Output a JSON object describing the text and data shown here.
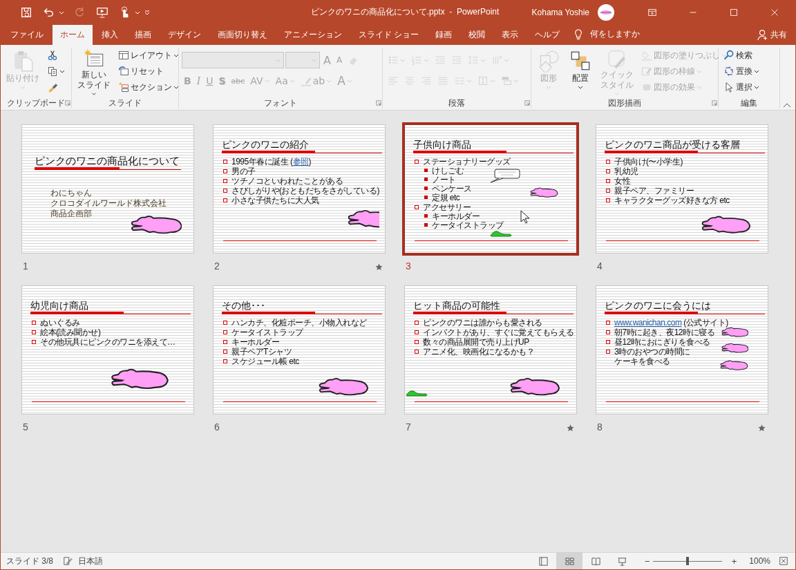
{
  "window": {
    "title": "ピンクのワニの商品化について.pptx  -  PowerPoint",
    "user": "Kohama Yoshie"
  },
  "tabs": [
    {
      "label": "ファイル",
      "selected": false
    },
    {
      "label": "ホーム",
      "selected": true
    },
    {
      "label": "挿入",
      "selected": false
    },
    {
      "label": "描画",
      "selected": false
    },
    {
      "label": "デザイン",
      "selected": false
    },
    {
      "label": "画面切り替え",
      "selected": false
    },
    {
      "label": "アニメーション",
      "selected": false
    },
    {
      "label": "スライド ショー",
      "selected": false
    },
    {
      "label": "録画",
      "selected": false
    },
    {
      "label": "校閲",
      "selected": false
    },
    {
      "label": "表示",
      "selected": false
    },
    {
      "label": "ヘルプ",
      "selected": false
    }
  ],
  "tell_me": "何をしますか",
  "share": "共有",
  "ribbon": {
    "groups": [
      {
        "kind": "stack",
        "label": "クリップボード",
        "launcher": true,
        "columns": [
          {
            "items": [
              {
                "kind": "paste",
                "label": "貼り付け",
                "caret": true,
                "disabled": true
              }
            ]
          },
          {
            "items": [
              {
                "kind": "cut",
                "caret": false,
                "disabled": false
              },
              {
                "kind": "copy",
                "caret": true,
                "disabled": false
              },
              {
                "kind": "painter",
                "caret": false,
                "disabled": false
              }
            ]
          }
        ]
      },
      {
        "kind": "stack",
        "label": "スライド",
        "launcher": false,
        "columns": [
          {
            "items": [
              {
                "kind": "new_slide",
                "lines": [
                  "新しい",
                  "スライド"
                ],
                "caret": true,
                "disabled": false
              }
            ]
          },
          {
            "items": [
              {
                "kind": "layout",
                "label": "レイアウト",
                "caret": true,
                "disabled": false
              },
              {
                "kind": "reset",
                "label": "リセット",
                "caret": false,
                "disabled": false
              },
              {
                "kind": "section",
                "label": "セクション",
                "caret": true,
                "disabled": false
              }
            ]
          }
        ]
      },
      {
        "kind": "rows",
        "label": "フォント",
        "launcher": true,
        "rows": [
          {
            "items": [
              {
                "kind": "font_name",
                "caret": true,
                "disabled": true
              },
              {
                "kind": "font_size",
                "caret": true,
                "disabled": true
              },
              {
                "kind": "grow",
                "label": "A",
                "caret": false,
                "disabled": true
              },
              {
                "kind": "shrink",
                "label": "A",
                "caret": false,
                "disabled": true
              },
              {
                "kind": "clear",
                "caret": false,
                "disabled": true
              }
            ]
          },
          {
            "items": [
              {
                "kind": "bold",
                "label": "B",
                "caret": false,
                "disabled": true
              },
              {
                "kind": "italic",
                "label": "I",
                "caret": false,
                "disabled": true
              },
              {
                "kind": "underline",
                "label": "U",
                "caret": false,
                "disabled": true
              },
              {
                "kind": "shadow",
                "label": "S",
                "caret": false,
                "disabled": true
              },
              {
                "kind": "strike",
                "label": "abc",
                "caret": false,
                "disabled": true
              },
              {
                "kind": "spacing",
                "label": "AV",
                "caret": true,
                "disabled": true
              },
              {
                "kind": "case",
                "label": "Aa",
                "caret": true,
                "disabled": true
              },
              {
                "kind": "highlight",
                "label": "ab",
                "caret": true,
                "disabled": true
              },
              {
                "kind": "color",
                "label": "A",
                "caret": true,
                "disabled": true
              }
            ]
          }
        ]
      },
      {
        "kind": "rows",
        "label": "段落",
        "launcher": true,
        "rows": [
          {
            "items": [
              {
                "kind": "bullets",
                "caret": true,
                "disabled": true
              },
              {
                "kind": "numbering",
                "caret": true,
                "disabled": true
              },
              {
                "kind": "outdent",
                "caret": false,
                "disabled": true
              },
              {
                "kind": "indent",
                "caret": false,
                "disabled": true
              },
              {
                "kind": "line_spacing",
                "caret": true,
                "disabled": true
              },
              {
                "kind": "text_direction",
                "caret": true,
                "disabled": true
              }
            ]
          },
          {
            "items": [
              {
                "kind": "left",
                "caret": false,
                "disabled": true
              },
              {
                "kind": "center",
                "caret": false,
                "disabled": true
              },
              {
                "kind": "right",
                "caret": false,
                "disabled": true
              },
              {
                "kind": "justify",
                "caret": false,
                "disabled": true
              },
              {
                "kind": "columns",
                "caret": true,
                "disabled": true
              },
              {
                "kind": "align_text",
                "caret": true,
                "disabled": true
              },
              {
                "kind": "smartart",
                "caret": true,
                "disabled": true
              }
            ]
          }
        ]
      },
      {
        "kind": "stack",
        "label": "図形描画",
        "launcher": true,
        "columns": [
          {
            "items": [
              {
                "kind": "shapes",
                "label": "図形",
                "caret": true,
                "disabled": true
              }
            ]
          },
          {
            "items": [
              {
                "kind": "arrange",
                "label": "配置",
                "caret": true,
                "disabled": false
              }
            ]
          },
          {
            "items": [
              {
                "kind": "quick_styles",
                "lines": [
                  "クイック",
                  "スタイル"
                ],
                "caret": true,
                "disabled": true
              }
            ]
          },
          {
            "items": [
              {
                "kind": "fill",
                "label": "図形の塗りつぶし",
                "caret": true,
                "disabled": true
              },
              {
                "kind": "outline",
                "label": "図形の枠線",
                "caret": true,
                "disabled": true
              },
              {
                "kind": "effects",
                "label": "図形の効果",
                "caret": true,
                "disabled": true
              }
            ]
          }
        ]
      },
      {
        "kind": "stack",
        "label": "編集",
        "launcher": false,
        "columns": [
          {
            "items": [
              {
                "kind": "find",
                "label": "検索",
                "caret": false,
                "disabled": false
              },
              {
                "kind": "replace",
                "label": "置換",
                "caret": true,
                "disabled": false
              },
              {
                "kind": "select",
                "label": "選択",
                "caret": true,
                "disabled": false
              }
            ]
          }
        ]
      }
    ]
  },
  "slides": [
    {
      "number": "1",
      "kind": "title",
      "title": "ピンクのワニの商品化について",
      "subtitle": [
        "わにちゃん",
        "クロコダイルワールド株式会社",
        "商品企画部"
      ],
      "selected": false,
      "transition": false,
      "art": [
        {
          "kind": "crocodile"
        }
      ]
    },
    {
      "number": "2",
      "kind": "content",
      "title": "ピンクのワニの紹介",
      "bullets": [
        {
          "parts": [
            {
              "kind": "text",
              "text": "1995年春に誕生 ("
            },
            {
              "kind": "link",
              "text": "参照"
            },
            {
              "kind": "text",
              "text": ")"
            }
          ]
        },
        {
          "text": "男の子"
        },
        {
          "text": "ツチノコといわれたことがある"
        },
        {
          "text": "さびしがりや(おともだちをさがしている)"
        },
        {
          "text": "小さな子供たちに大人気"
        }
      ],
      "selected": false,
      "transition": true,
      "art": [
        {
          "kind": "crocodile"
        }
      ]
    },
    {
      "number": "3",
      "kind": "content",
      "title": "子供向け商品",
      "bullets": [
        {
          "text": "ステーショナリーグッズ",
          "children": [
            {
              "text": "けしごむ"
            },
            {
              "text": "ノート"
            },
            {
              "text": "ペンケース"
            },
            {
              "text": "定規 etc"
            }
          ]
        },
        {
          "text": "アクセサリー",
          "children": [
            {
              "text": "キーホルダー"
            },
            {
              "text": "ケータイストラップ"
            }
          ]
        }
      ],
      "selected": true,
      "transition": false,
      "art": [
        {
          "kind": "bubble"
        },
        {
          "kind": "crocodile"
        },
        {
          "kind": "cursor"
        },
        {
          "kind": "caterpillar"
        }
      ]
    },
    {
      "number": "4",
      "kind": "content",
      "title": "ピンクのワニ商品が受ける客層",
      "bullets": [
        {
          "text": "子供向け(〜小学生)"
        },
        {
          "text": "乳幼児"
        },
        {
          "text": "女性"
        },
        {
          "text": "親子ペア、ファミリー"
        },
        {
          "text": "キャラクターグッズ好きな方 etc"
        }
      ],
      "selected": false,
      "transition": false,
      "art": [
        {
          "kind": "crocodile"
        }
      ]
    },
    {
      "number": "5",
      "kind": "content",
      "title": "幼児向け商品",
      "bullets": [
        {
          "text": "ぬいぐるみ"
        },
        {
          "text": "絵本(読み聞かせ)"
        },
        {
          "text": "その他玩具にピンクのワニを添えて…"
        }
      ],
      "selected": false,
      "transition": false,
      "art": [
        {
          "kind": "crocodile"
        }
      ]
    },
    {
      "number": "6",
      "kind": "content",
      "title": "その他･･･",
      "bullets": [
        {
          "text": "ハンカチ、化粧ポーチ、小物入れなど"
        },
        {
          "text": "ケータイストラップ"
        },
        {
          "text": "キーホルダー"
        },
        {
          "text": "親子ペアTシャツ"
        },
        {
          "text": "スケジュール帳 etc"
        }
      ],
      "selected": false,
      "transition": false,
      "art": [
        {
          "kind": "crocodile"
        }
      ]
    },
    {
      "number": "7",
      "kind": "content",
      "title": "ヒット商品の可能性",
      "bullets": [
        {
          "text": "ピンクのワニは誰からも愛される"
        },
        {
          "text": "インパクトがあり、すぐに覚えてもらえる"
        },
        {
          "text": "数々の商品展開で売り上げUP"
        },
        {
          "text": "アニメ化、映画化になるかも？"
        }
      ],
      "selected": false,
      "transition": true,
      "art": [
        {
          "kind": "caterpillar"
        },
        {
          "kind": "crocodile"
        }
      ]
    },
    {
      "number": "8",
      "kind": "content",
      "title": "ピンクのワニに会うには",
      "bullets": [
        {
          "parts": [
            {
              "kind": "link",
              "text": "www.wanichan.com"
            },
            {
              "kind": "text",
              "text": " (公式サイト)"
            }
          ]
        },
        {
          "text": "朝7時に起き、夜12時に寝る"
        },
        {
          "text": "昼12時におにぎりを食べる"
        },
        {
          "lines": [
            "3時のおやつの時間に",
            "ケーキを食べる"
          ]
        }
      ],
      "selected": false,
      "transition": true,
      "art": [
        {
          "kind": "crocodile"
        },
        {
          "kind": "crocodile"
        },
        {
          "kind": "crocodile"
        }
      ]
    }
  ],
  "status_bar": {
    "slide": "スライド 3/8",
    "language": "日本語",
    "views": [
      {
        "kind": "normal",
        "selected": false
      },
      {
        "kind": "sorter",
        "selected": true
      },
      {
        "kind": "reading",
        "selected": false
      },
      {
        "kind": "slideshow",
        "selected": false
      }
    ],
    "zoom_out": "−",
    "zoom_in": "+",
    "zoom": {
      "level": 0.5
    },
    "zoom_text": "100%"
  }
}
